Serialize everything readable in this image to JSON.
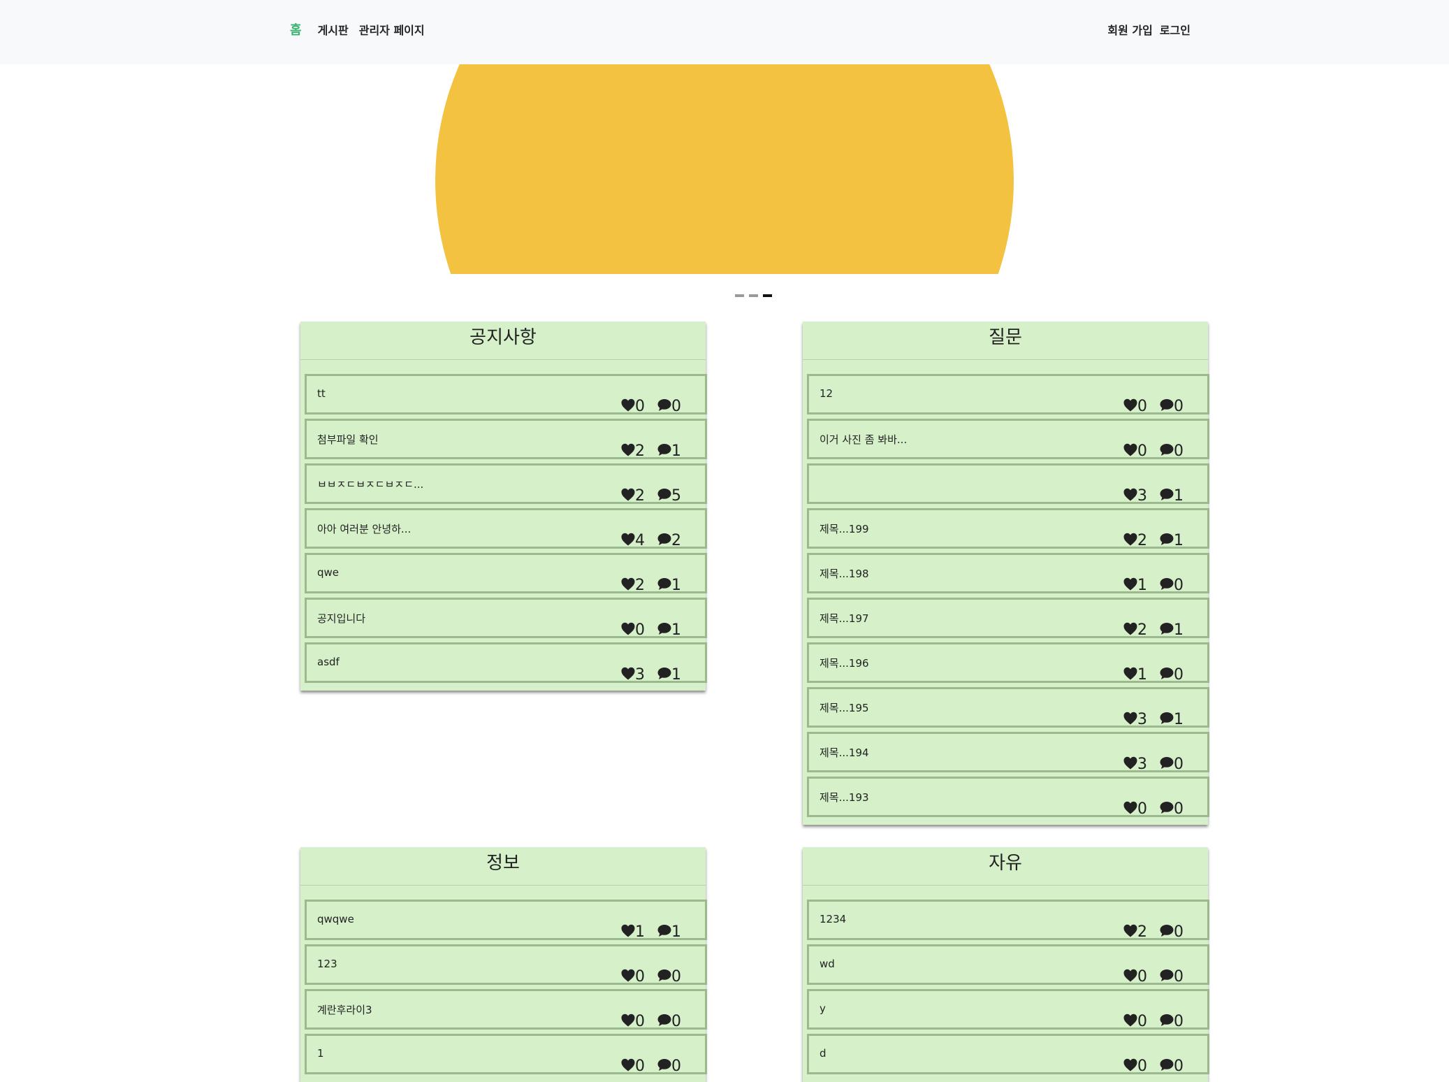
{
  "nav": {
    "home": "홈",
    "board": "게시판",
    "admin": "관리자 페이지",
    "signup": "회원 가입",
    "login": "로그인"
  },
  "carousel": {
    "active_index": 2,
    "count": 3,
    "slide_color": "#f3c240"
  },
  "colors": {
    "card_bg": "#d6f0ca",
    "card_border": "#9bb88f",
    "nav_active": "#3cb371"
  },
  "boards": [
    {
      "title": "공지사항",
      "posts": [
        {
          "title": "tt",
          "likes": "0",
          "comments": "0"
        },
        {
          "title": "첨부파일 확인",
          "likes": "2",
          "comments": "1"
        },
        {
          "title": "ㅂㅂㅈㄷㅂㅈㄷㅂㅈㄷ...",
          "likes": "2",
          "comments": "5"
        },
        {
          "title": "아아 여러분 안녕하...",
          "likes": "4",
          "comments": "2"
        },
        {
          "title": "qwe",
          "likes": "2",
          "comments": "1"
        },
        {
          "title": "공지입니다",
          "likes": "0",
          "comments": "1"
        },
        {
          "title": "asdf",
          "likes": "3",
          "comments": "1"
        }
      ]
    },
    {
      "title": "질문",
      "posts": [
        {
          "title": "12",
          "likes": "0",
          "comments": "0"
        },
        {
          "title": "이거 사진 좀 봐바...",
          "likes": "0",
          "comments": "0"
        },
        {
          "title": "",
          "likes": "3",
          "comments": "1"
        },
        {
          "title": "제목...199",
          "likes": "2",
          "comments": "1"
        },
        {
          "title": "제목...198",
          "likes": "1",
          "comments": "0"
        },
        {
          "title": "제목...197",
          "likes": "2",
          "comments": "1"
        },
        {
          "title": "제목...196",
          "likes": "1",
          "comments": "0"
        },
        {
          "title": "제목...195",
          "likes": "3",
          "comments": "1"
        },
        {
          "title": "제목...194",
          "likes": "3",
          "comments": "0"
        },
        {
          "title": "제목...193",
          "likes": "0",
          "comments": "0"
        }
      ]
    },
    {
      "title": "정보",
      "posts": [
        {
          "title": "qwqwe",
          "likes": "1",
          "comments": "1"
        },
        {
          "title": "123",
          "likes": "0",
          "comments": "0"
        },
        {
          "title": "계란후라이3",
          "likes": "0",
          "comments": "0"
        },
        {
          "title": "1",
          "likes": "0",
          "comments": "0"
        }
      ]
    },
    {
      "title": "자유",
      "posts": [
        {
          "title": "1234",
          "likes": "2",
          "comments": "0"
        },
        {
          "title": "wd",
          "likes": "0",
          "comments": "0"
        },
        {
          "title": "y",
          "likes": "0",
          "comments": "0"
        },
        {
          "title": "d",
          "likes": "0",
          "comments": "0"
        }
      ]
    }
  ],
  "icons": {
    "like": "heart-icon",
    "comment": "comment-icon"
  }
}
